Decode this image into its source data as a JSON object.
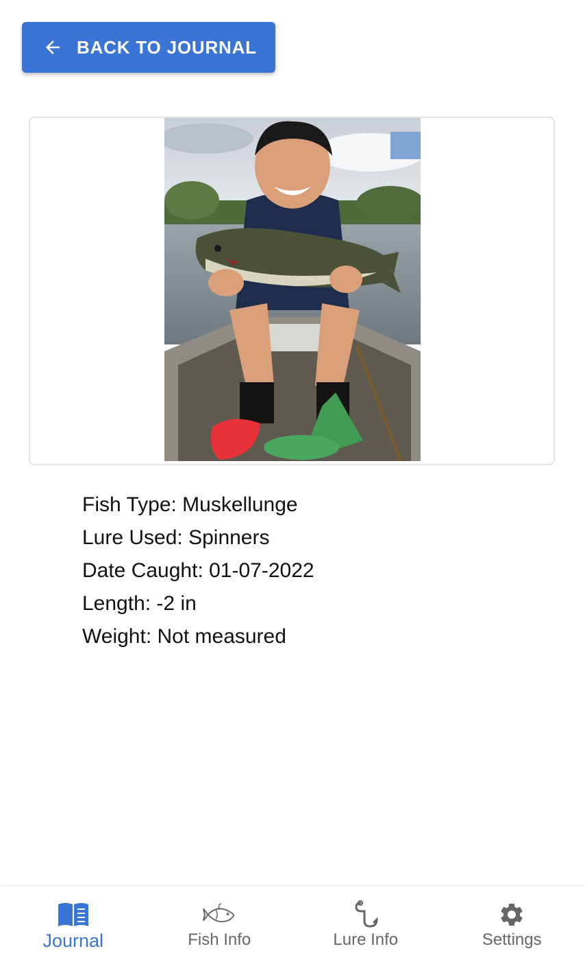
{
  "back_button": {
    "label": "BACK TO JOURNAL",
    "icon": "arrow-left-icon"
  },
  "photo": {
    "description_icon": "catch-photo"
  },
  "details": {
    "fish_type": "Fish Type: Muskellunge",
    "lure_used": "Lure Used: Spinners",
    "date_caught": "Date Caught: 01-07-2022",
    "length": "Length: -2 in",
    "weight": "Weight: Not measured"
  },
  "bottom_nav": {
    "items": [
      {
        "label": "Journal",
        "icon": "book-icon",
        "active": true
      },
      {
        "label": "Fish Info",
        "icon": "fish-icon",
        "active": false
      },
      {
        "label": "Lure Info",
        "icon": "hook-icon",
        "active": false
      },
      {
        "label": "Settings",
        "icon": "gear-icon",
        "active": false
      }
    ]
  },
  "colors": {
    "accent": "#3a74d4",
    "inactive_nav": "#666666",
    "text": "#111111"
  }
}
